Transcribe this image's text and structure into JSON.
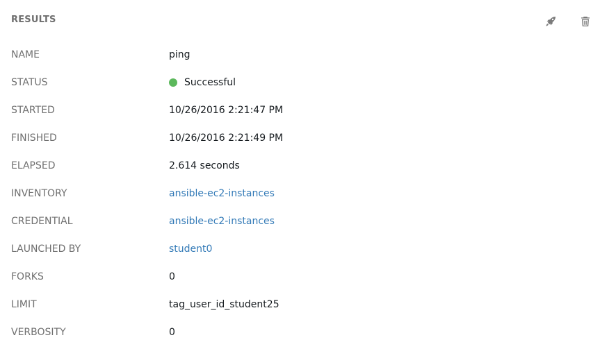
{
  "header": {
    "title": "RESULTS",
    "actions": [
      {
        "name": "relaunch",
        "icon": "rocket-icon"
      },
      {
        "name": "delete",
        "icon": "trash-icon"
      }
    ]
  },
  "details": {
    "name": {
      "label": "NAME",
      "value": "ping"
    },
    "status": {
      "label": "STATUS",
      "value": "Successful",
      "color": "#5cb85c"
    },
    "started": {
      "label": "STARTED",
      "value": "10/26/2016 2:21:47 PM"
    },
    "finished": {
      "label": "FINISHED",
      "value": "10/26/2016 2:21:49 PM"
    },
    "elapsed": {
      "label": "ELAPSED",
      "value": "2.614 seconds"
    },
    "inventory": {
      "label": "INVENTORY",
      "value": "ansible-ec2-instances"
    },
    "credential": {
      "label": "CREDENTIAL",
      "value": "ansible-ec2-instances"
    },
    "launched_by": {
      "label": "LAUNCHED BY",
      "value": "student0"
    },
    "forks": {
      "label": "FORKS",
      "value": "0"
    },
    "limit": {
      "label": "LIMIT",
      "value": "tag_user_id_student25"
    },
    "verbosity": {
      "label": "VERBOSITY",
      "value": "0"
    }
  },
  "colors": {
    "link": "#337ab7",
    "label": "#707070",
    "success": "#5cb85c"
  }
}
